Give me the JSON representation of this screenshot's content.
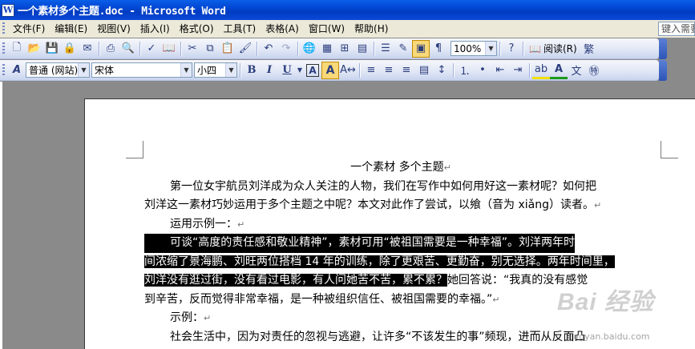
{
  "window": {
    "title": "一个素材多个主题.doc - Microsoft Word",
    "icon_letter": "W"
  },
  "menubar": {
    "items": [
      "文件(F)",
      "编辑(E)",
      "视图(V)",
      "插入(I)",
      "格式(O)",
      "工具(T)",
      "表格(A)",
      "窗口(W)",
      "帮助(H)"
    ],
    "help_placeholder": "键入需要"
  },
  "standard_toolbar": {
    "zoom": "100%",
    "read_label": "阅读(R)"
  },
  "formatting_toolbar": {
    "style": "普通 (网站)",
    "font": "宋体",
    "size": "小四"
  },
  "document": {
    "title": "一个素材 多个主题",
    "para1": "第一位女宇航员刘洋成为众人关注的人物，我们在写作中如何用好这一素材呢？如何把",
    "para1b": "刘洋这一素材巧妙运用于多个主题之中呢？本文对此作了尝试，以飨（音为 xiǎng）读者。",
    "example1": "运用示例一：",
    "sel1": "可谈“高度的责任感和敬业精神”，素材可用“被祖国需要是一种幸福”。刘洋两年时",
    "sel2": "间浓缩了景海鹏、刘旺两位搭档 14 年的训练，除了更艰苦、更勤奋，别无选择。两年时间里，",
    "sel3": "刘洋没有逛过街，没有看过电影，有人问她苦不苦，累不累？",
    "after_sel": "她回答说：“我真的没有感觉",
    "para3": "到辛苦，反而觉得非常幸福，是一种被组织信任、被祖国需要的幸福。”",
    "example2": "示例：",
    "para4": "社会生活中，因为对责任的忽视与逃避，让许多“不该发生的事”频现，进而从反面凸"
  },
  "watermark": {
    "main": "Bai 经验",
    "sub": "jingyan.baidu.com"
  }
}
